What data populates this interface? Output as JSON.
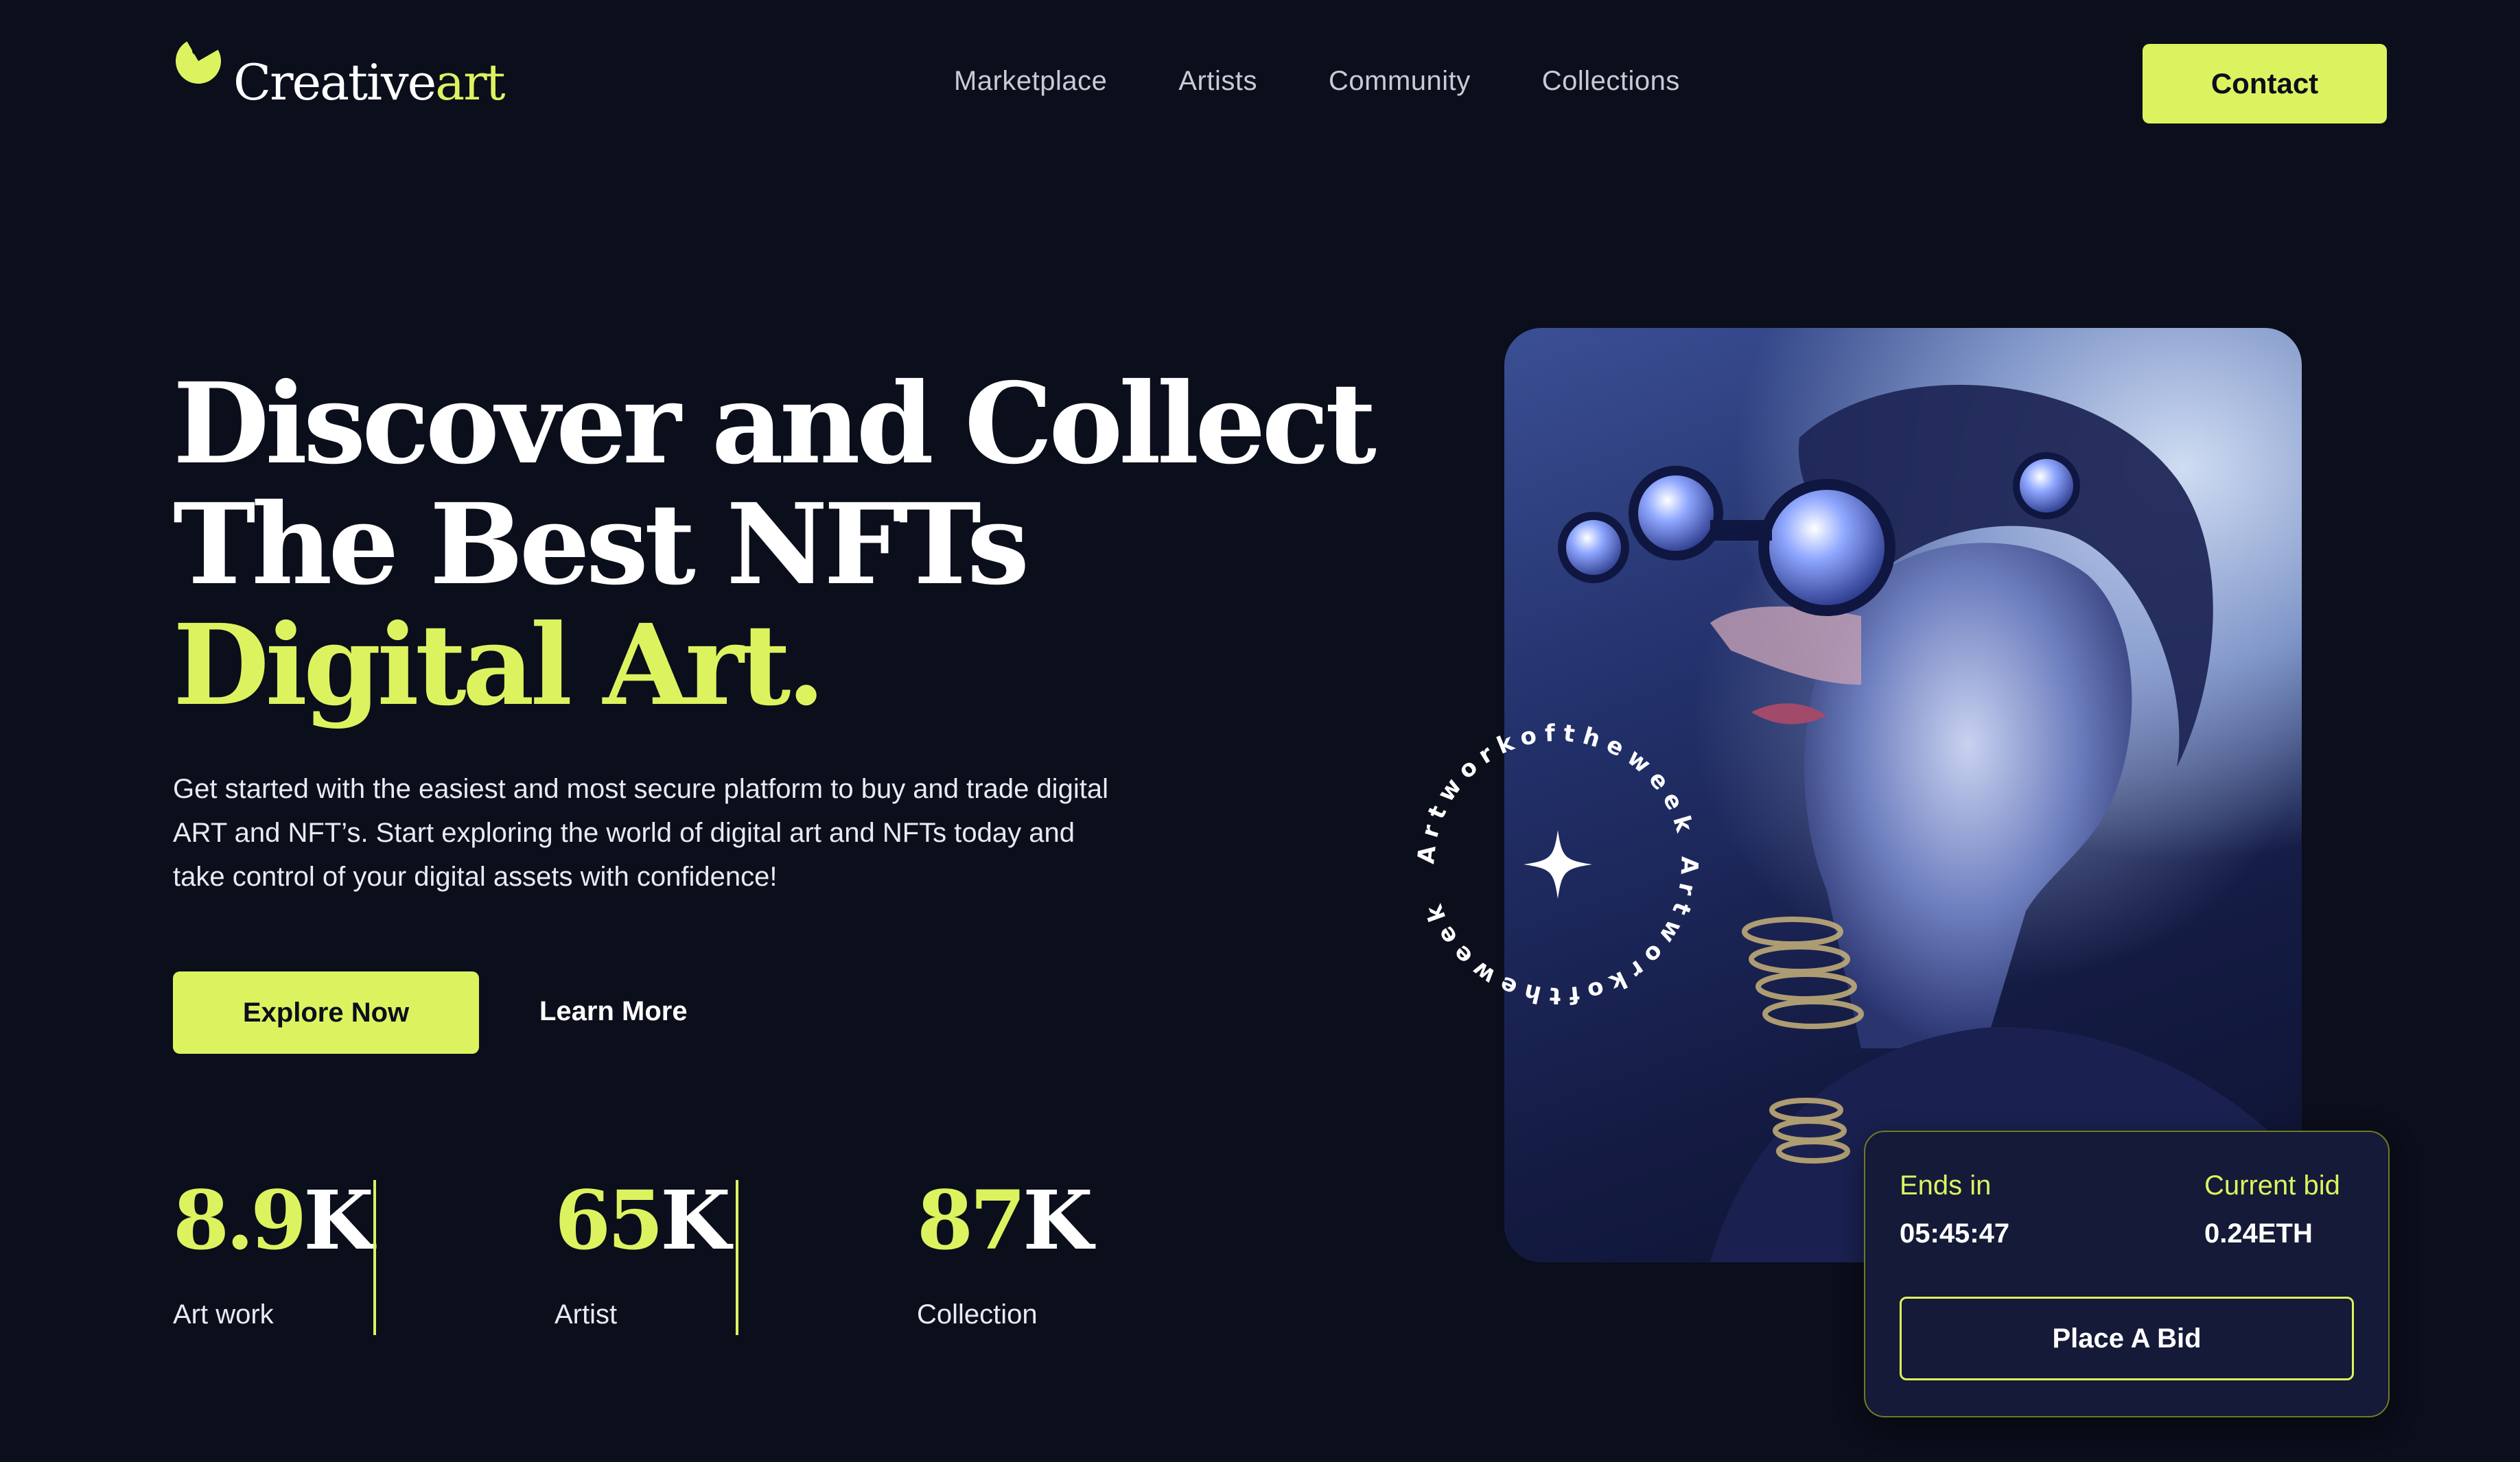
{
  "brand": {
    "name_main": "Creative",
    "name_accent": "art"
  },
  "nav": [
    "Marketplace",
    "Artists",
    "Community",
    "Collections"
  ],
  "header": {
    "contact_label": "Contact"
  },
  "hero": {
    "line1": "Discover and Collect",
    "line2": "The Best NFTs",
    "line3": "Digital Art.",
    "description": "Get started with the easiest and most secure platform to buy and trade digital ART and NFT’s. Start exploring the world of digital art and NFTs today and take control of your digital assets with confidence!",
    "explore_label": "Explore Now",
    "learn_label": "Learn More"
  },
  "stats": [
    {
      "lead": "8.9",
      "rest": "K",
      "label": "Art work"
    },
    {
      "lead": "65",
      "rest": "K",
      "label": "Artist"
    },
    {
      "lead": "87",
      "rest": "K",
      "label": "Collection"
    }
  ],
  "badge": {
    "text": "Artworkoftheweek Artworkoftheweek",
    "icon": "sparkle-icon"
  },
  "bid": {
    "ends_label": "Ends in",
    "ends_value": "05:45:47",
    "current_label": "Current bid",
    "current_value": "0.24ETH",
    "button_label": "Place A Bid"
  },
  "colors": {
    "background": "#0b0e1b",
    "accent": "#dcf35f",
    "card": "#141a37"
  }
}
